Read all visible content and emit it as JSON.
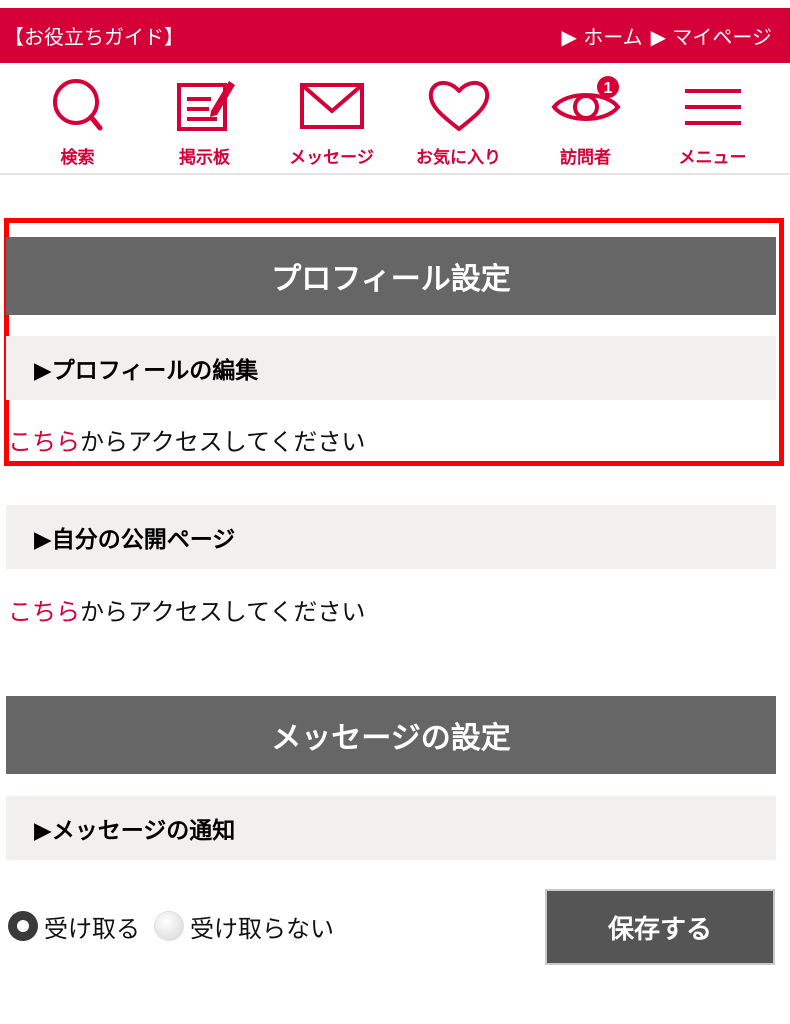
{
  "header": {
    "guide_label": "【お役立ちガイド】",
    "home_link": "▶ ホーム",
    "mypage_link": "▶ マイページ"
  },
  "nav": [
    {
      "label": "検索",
      "icon": "search-icon"
    },
    {
      "label": "掲示板",
      "icon": "board-icon"
    },
    {
      "label": "メッセージ",
      "icon": "mail-icon"
    },
    {
      "label": "お気に入り",
      "icon": "heart-icon"
    },
    {
      "label": "訪問者",
      "icon": "eye-icon",
      "badge": "1"
    },
    {
      "label": "メニュー",
      "icon": "hamburger-icon"
    }
  ],
  "profile_section": {
    "title": "プロフィール設定",
    "edit_heading": "▶プロフィールの編集",
    "edit_link": "こちら",
    "edit_text": "からアクセスしてください",
    "public_heading": "▶自分の公開ページ",
    "public_link": "こちら",
    "public_text": "からアクセスしてください"
  },
  "message_section": {
    "title": "メッセージの設定",
    "notify_heading": "▶メッセージの通知",
    "options": [
      {
        "label": "受け取る",
        "checked": true
      },
      {
        "label": "受け取らない",
        "checked": false
      }
    ],
    "save_label": "保存する"
  },
  "colors": {
    "brand": "#d50037",
    "header_gray": "#666666",
    "subheader_bg": "#f1f0ef",
    "highlight": "#ff0000"
  }
}
